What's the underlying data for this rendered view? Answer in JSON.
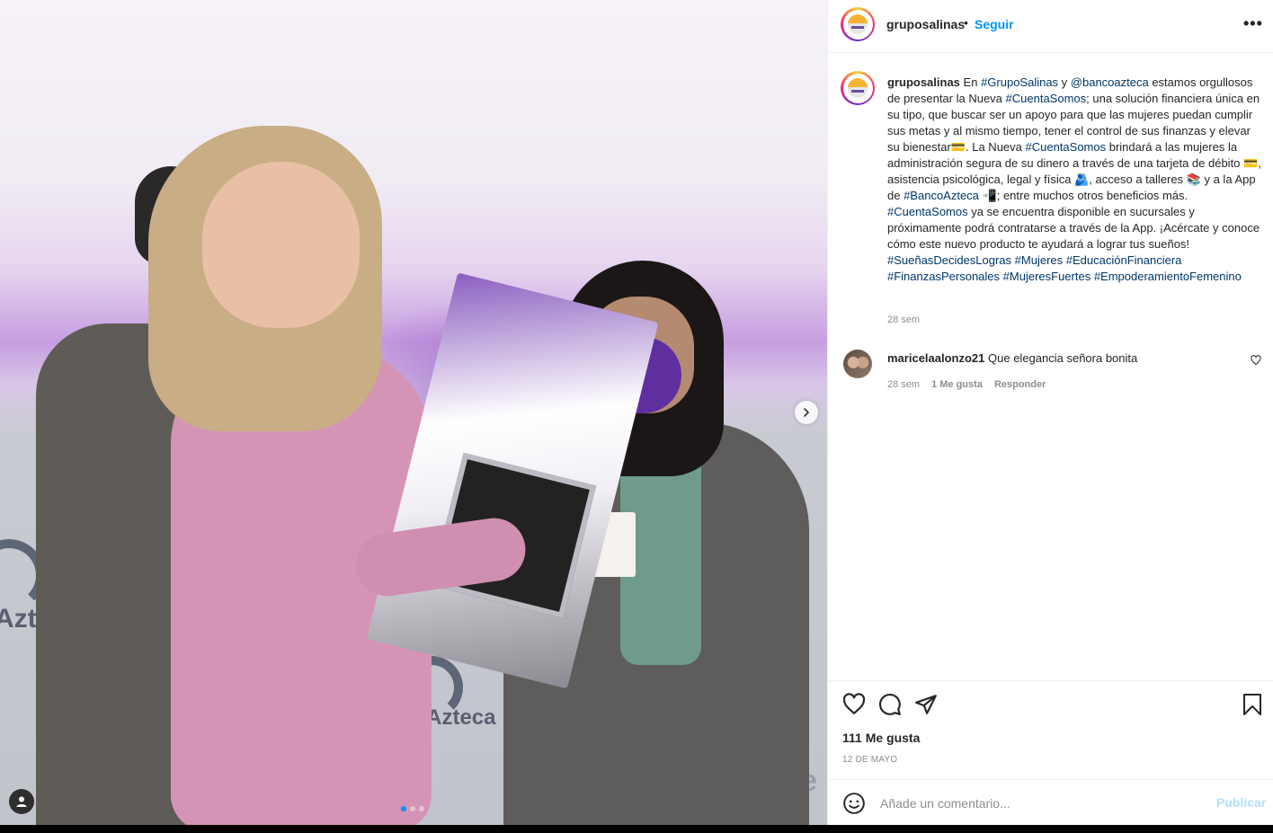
{
  "header": {
    "username": "gruposalinas",
    "separator": "•",
    "follow_label": "Seguir",
    "more_label": "•••"
  },
  "caption": {
    "username": "gruposalinas",
    "text": "En #GrupoSalinas y @bancoazteca estamos orgullosos de presentar la Nueva #CuentaSomos; una solución financiera única en su tipo, que buscar ser un apoyo para que las mujeres puedan cumplir sus metas y al mismo tiempo, tener el control de sus finanzas y elevar su bienestar💳. La Nueva #CuentaSomos brindará a las mujeres la administración segura de su dinero a través de una tarjeta de débito 💳, asistencia psicológica, legal y física 🫂, acceso a talleres 📚 y a la App de #BancoAzteca 📲; entre muchos otros beneficios más. #CuentaSomos ya se encuentra disponible en sucursales y próximamente podrá contratarse a través de la App. ¡Acércate y conoce cómo este nuevo producto te ayudará a lograr tus sueños! #SueñasDecidesLogras #Mujeres #EducaciónFinanciera #FinanzasPersonales #MujeresFuertes #EmpoderamientoFemenino",
    "time": "28 sem"
  },
  "comment": {
    "username": "maricelaalonzo21",
    "text": "Que elegancia señora bonita",
    "time": "28 sem",
    "likes": "1 Me gusta",
    "reply_label": "Responder"
  },
  "stats": {
    "likes": "111 Me gusta",
    "date": "12 DE MAYO"
  },
  "add_comment": {
    "placeholder": "Añade un comentario...",
    "post_label": "Publicar"
  },
  "media": {
    "stage_text_1": "Azteca",
    "stage_text_2": "a Azteca",
    "stage_text_3": "me",
    "carousel_count": 3,
    "carousel_active": 1
  },
  "colors": {
    "link": "#00376b",
    "accent": "#0095f6",
    "post_disabled": "#b2dffc"
  }
}
